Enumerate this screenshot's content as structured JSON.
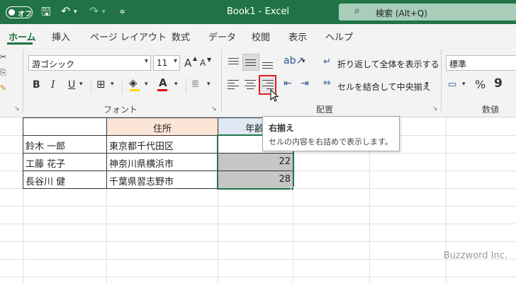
{
  "titlebar": {
    "autosave_label": "オフ",
    "title": "Book1  -  Excel",
    "search_placeholder": "検索 (Alt+Q)"
  },
  "tabs": [
    "ホーム",
    "挿入",
    "ページ レイアウト",
    "数式",
    "データ",
    "校閲",
    "表示",
    "ヘルプ"
  ],
  "ribbon": {
    "font_name": "游ゴシック",
    "font_size": "11",
    "grow_font": "A",
    "shrink_font": "A",
    "bold": "B",
    "italic": "I",
    "underline": "U",
    "font_color_glyph": "A",
    "phonetic_glyph": "亜",
    "wrap_text_label": "折り返して全体を表示する",
    "merge_center_label": "セルを結合して中央揃え",
    "number_format": "標準",
    "percent": "%",
    "comma": "9",
    "group_font": "フォント",
    "group_alignment": "配置",
    "group_number": "数値"
  },
  "tooltip": {
    "title": "右揃え",
    "description": "セルの内容を右詰めで表示します。"
  },
  "sheet": {
    "headers": [
      "住所",
      "年齢"
    ],
    "rows": [
      {
        "name": "鈴木 一郎",
        "address": "東京都千代田区",
        "age": ""
      },
      {
        "name": "工藤 花子",
        "address": "神奈川県横浜市",
        "age": "22"
      },
      {
        "name": "長谷川 健",
        "address": "千葉県習志野市",
        "age": "28"
      }
    ]
  },
  "watermark": "Buzzword Inc.",
  "colors": {
    "excel_green": "#217346",
    "header_fill": "#fbe5d6",
    "selection_fill": "#c6c6c6",
    "highlight_border": "#e02020"
  }
}
